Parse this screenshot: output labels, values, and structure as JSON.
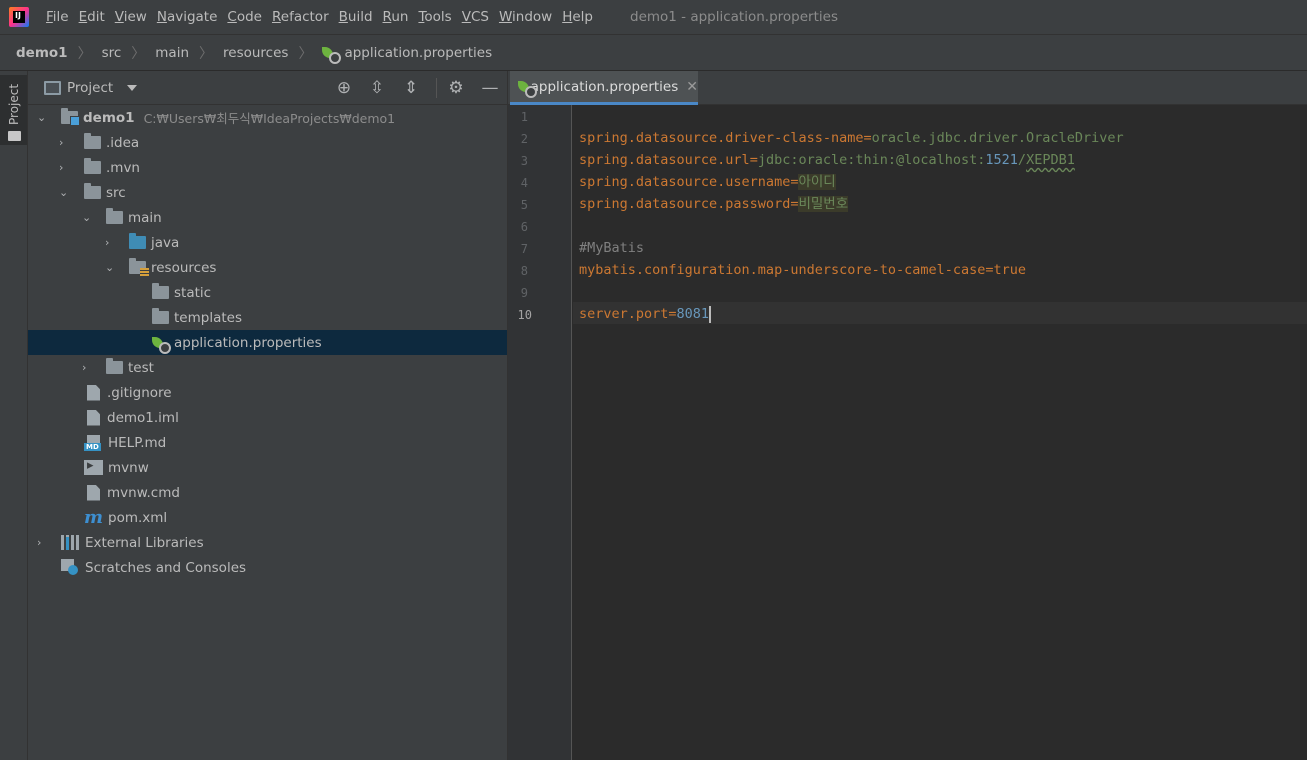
{
  "app": {
    "logo_text": "IJ",
    "menu": [
      "File",
      "Edit",
      "View",
      "Navigate",
      "Code",
      "Refactor",
      "Build",
      "Run",
      "Tools",
      "VCS",
      "Window",
      "Help"
    ],
    "window_title": "demo1 - application.properties"
  },
  "breadcrumb": [
    "demo1",
    "src",
    "main",
    "resources",
    "application.properties"
  ],
  "tool_strip": {
    "project_tab": "Project"
  },
  "project_panel": {
    "title": "Project",
    "tree": [
      {
        "label": "demo1",
        "path": "C:₩Users₩최두식₩IdeaProjects₩demo1",
        "expanded": true
      },
      {
        "label": ".idea",
        "expanded": false
      },
      {
        "label": ".mvn",
        "expanded": false
      },
      {
        "label": "src",
        "expanded": true
      },
      {
        "label": "main",
        "expanded": true
      },
      {
        "label": "java",
        "expanded": false
      },
      {
        "label": "resources",
        "expanded": true
      },
      {
        "label": "static"
      },
      {
        "label": "templates"
      },
      {
        "label": "application.properties",
        "selected": true
      },
      {
        "label": "test",
        "expanded": false
      },
      {
        "label": ".gitignore"
      },
      {
        "label": "demo1.iml"
      },
      {
        "label": "HELP.md"
      },
      {
        "label": "mvnw"
      },
      {
        "label": "mvnw.cmd"
      },
      {
        "label": "pom.xml"
      },
      {
        "label": "External Libraries",
        "expanded": false
      },
      {
        "label": "Scratches and Consoles"
      }
    ]
  },
  "editor": {
    "tab_label": "application.properties",
    "line_numbers": [
      "1",
      "2",
      "3",
      "4",
      "5",
      "6",
      "7",
      "8",
      "9",
      "10"
    ],
    "lines": {
      "l2_key": "spring.datasource.driver-class-name",
      "l2_val": "oracle.jdbc.driver.OracleDriver",
      "l3_key": "spring.datasource.url",
      "l3_val": "jdbc:oracle:thin:@localhost:",
      "l3_port": "1521",
      "l3_slash": "/",
      "l3_sid": "XEPDB1",
      "l4_key": "spring.datasource.username",
      "l4_val": "아이디",
      "l5_key": "spring.datasource.password",
      "l5_val": "비밀번호",
      "l7_comment": "#MyBatis",
      "l8_key": "mybatis.configuration.map-underscore-to-camel-case",
      "l8_val": "true",
      "l10_key": "server.port",
      "l10_val": "8081",
      "eq": "="
    },
    "active_line": "10"
  },
  "icons": {
    "locate": "crosshair-icon",
    "expand": "expand-all-icon",
    "collapse": "collapse-all-icon",
    "settings": "gear-icon",
    "hide": "minimize-icon",
    "spring": "spring-leaf-icon"
  }
}
